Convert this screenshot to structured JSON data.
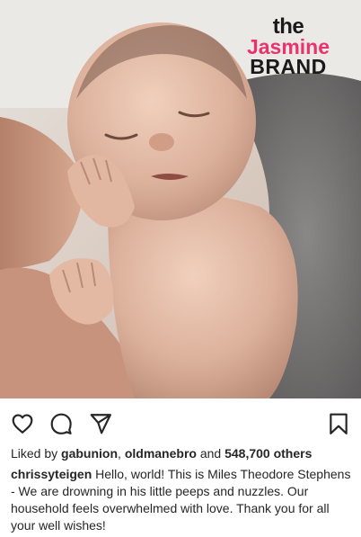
{
  "watermark": {
    "line1": "the",
    "line2": "Jasmine",
    "line3": "BRAND"
  },
  "actions": {
    "like_icon": "heart-outline-icon",
    "comment_icon": "comment-bubble-icon",
    "share_icon": "paper-plane-icon",
    "save_icon": "bookmark-icon"
  },
  "likes": {
    "prefix": "Liked by ",
    "user1": "gabunion",
    "sep": ", ",
    "user2": "oldmanebro",
    "and": " and ",
    "count": "548,700 others"
  },
  "caption": {
    "username": "chrissyteigen",
    "text": " Hello, world! This is Miles Theodore Stephens - We are drowning in his little peeps and nuzzles. Our household feels overwhelmed with love. Thank you for all your well wishes!"
  },
  "colors": {
    "text": "#262626",
    "brand_pink": "#e8336e"
  }
}
